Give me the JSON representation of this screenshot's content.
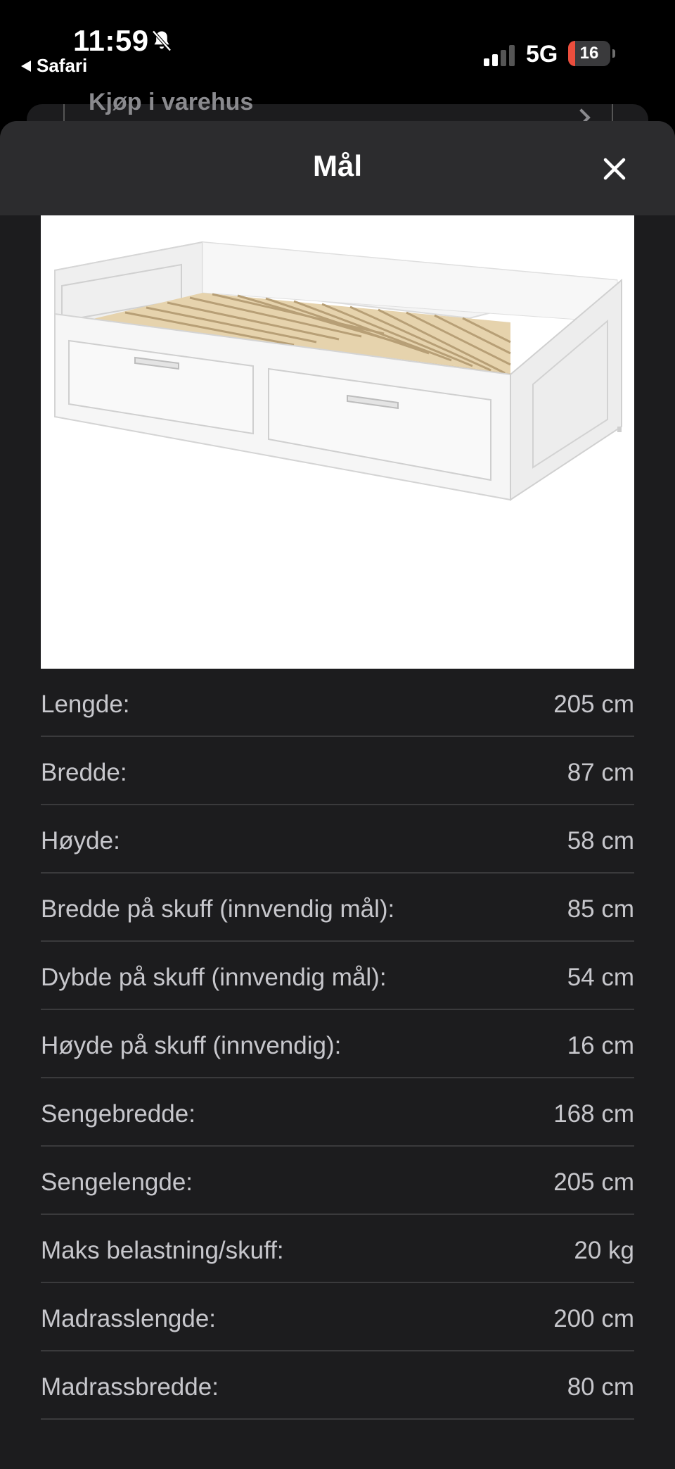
{
  "status_bar": {
    "time": "11:59",
    "back_app": "Safari",
    "network": "5G",
    "battery_level": "16",
    "battery_fraction": 0.16,
    "silent_icon": "bell-slash-icon",
    "signal_icon": "cellular-signal-icon"
  },
  "background_page": {
    "partial_text": "Kjøp i varehus"
  },
  "sheet": {
    "title": "Mål",
    "close_icon": "close-icon"
  },
  "product_image": {
    "alt": "bed-illustration"
  },
  "specs": [
    {
      "label": "Lengde:",
      "value": "205 cm"
    },
    {
      "label": "Bredde:",
      "value": "87 cm"
    },
    {
      "label": "Høyde:",
      "value": "58 cm"
    },
    {
      "label": "Bredde på skuff (innvendig mål):",
      "value": "85 cm"
    },
    {
      "label": "Dybde på skuff (innvendig mål):",
      "value": "54 cm"
    },
    {
      "label": "Høyde på skuff (innvendig):",
      "value": "16 cm"
    },
    {
      "label": "Sengebredde:",
      "value": "168 cm"
    },
    {
      "label": "Sengelengde:",
      "value": "205 cm"
    },
    {
      "label": "Maks belastning/skuff:",
      "value": "20 kg"
    },
    {
      "label": "Madrasslengde:",
      "value": "200 cm"
    },
    {
      "label": "Madrassbredde:",
      "value": "80 cm"
    }
  ]
}
